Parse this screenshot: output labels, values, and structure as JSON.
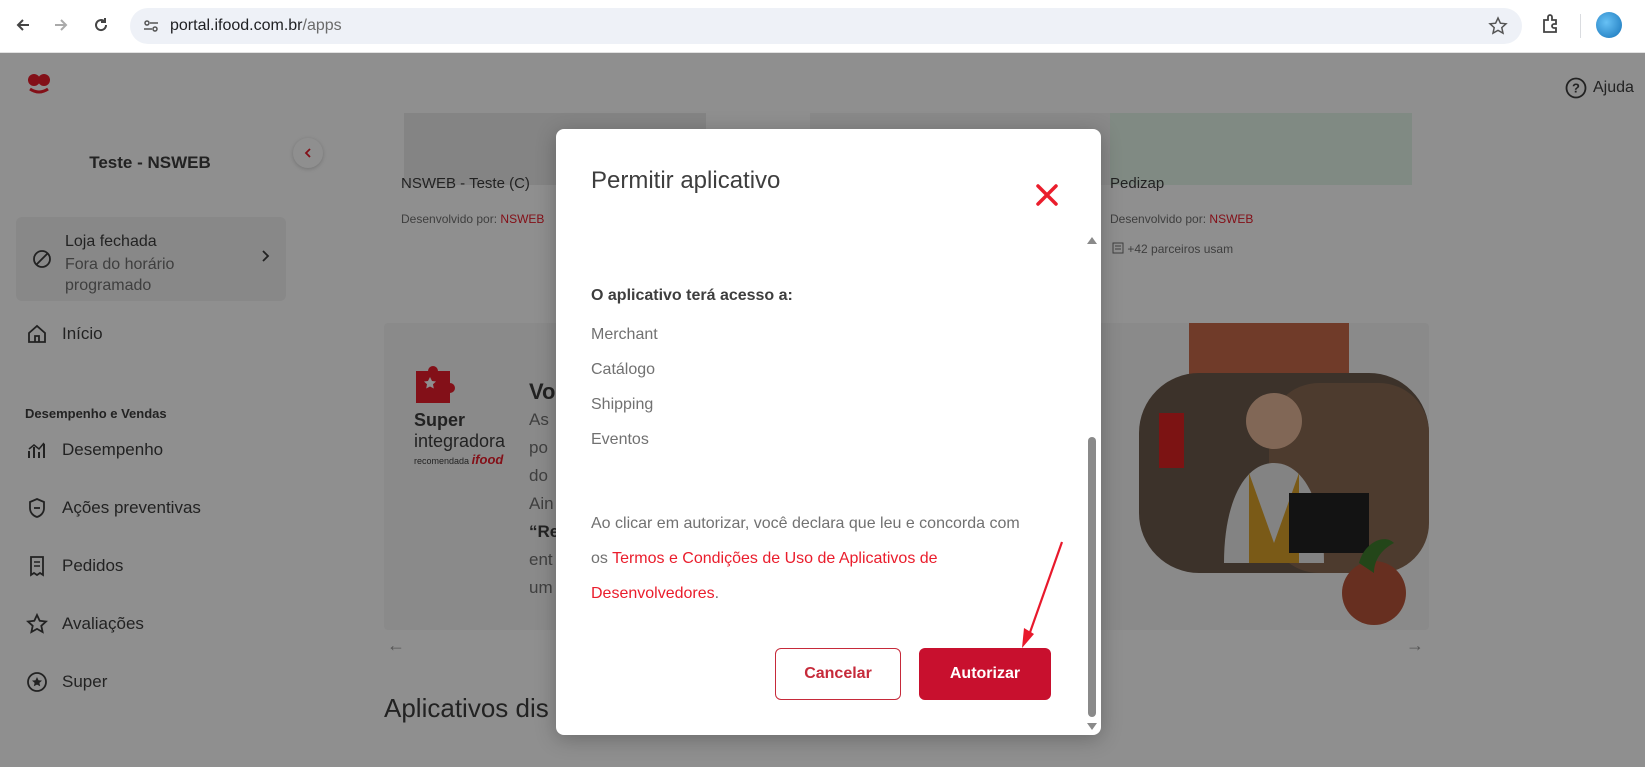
{
  "browser": {
    "url_host": "portal.ifood.com.br",
    "url_path": "/apps"
  },
  "header": {
    "help_label": "Ajuda"
  },
  "sidebar": {
    "store_name": "Teste - NSWEB",
    "store_status_title": "Loja fechada",
    "store_status_sub": "Fora do horário programado",
    "items": [
      {
        "label": "Início",
        "icon": "home-icon"
      },
      {
        "label": "Desempenho",
        "icon": "chart-icon"
      },
      {
        "label": "Ações preventivas",
        "icon": "shield-icon"
      },
      {
        "label": "Pedidos",
        "icon": "receipt-icon"
      },
      {
        "label": "Avaliações",
        "icon": "star-icon"
      },
      {
        "label": "Super",
        "icon": "super-icon"
      }
    ],
    "section_label": "Desempenho e Vendas"
  },
  "main": {
    "cards": [
      {
        "title": "NSWEB - Teste (C)",
        "dev_prefix": "Desenvolvido por:",
        "dev_name": "NSWEB"
      },
      {
        "title": "Pedizap",
        "dev_prefix": "Desenvolvido por:",
        "dev_name": "NSWEB",
        "users": "+42 parceiros usam"
      }
    ],
    "promo": {
      "badge_big": "Super",
      "badge_med": "integradora",
      "badge_small": "recomendada",
      "badge_brand": "ifood",
      "heading_fragment": "Vo",
      "text_fragments": [
        "As",
        "po",
        "do",
        "Ain",
        "“Re",
        "ent",
        "um"
      ]
    },
    "section_title": "Aplicativos dis"
  },
  "modal": {
    "title": "Permitir aplicativo",
    "access_heading": "O aplicativo terá acesso a:",
    "permissions": [
      "Merchant",
      "Catálogo",
      "Shipping",
      "Eventos"
    ],
    "terms_prefix": "Ao clicar em autorizar, você declara que leu e concorda com os ",
    "terms_link": "Termos e Condições de Uso de Aplicativos de Desenvolvedores",
    "terms_suffix": ".",
    "cancel_label": "Cancelar",
    "authorize_label": "Autorizar"
  },
  "colors": {
    "brand_red": "#ea1d2c",
    "button_red": "#c8102e"
  }
}
